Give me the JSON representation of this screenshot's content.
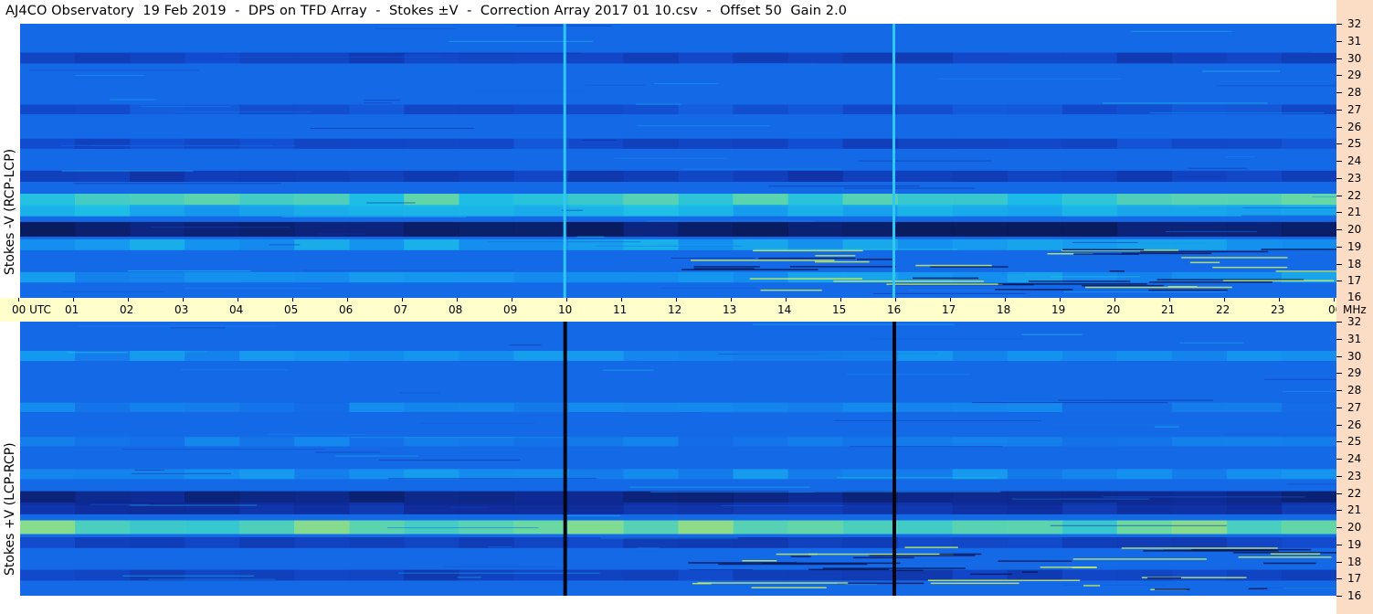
{
  "title": "AJ4CO Observatory  19 Feb 2019  -  DPS on TFD Array  -  Stokes ±V  -  Correction Array 2017 01 10.csv  -  Offset 50  Gain 2.0",
  "panels": [
    {
      "label": "Stokes -V (RCP-LCP)"
    },
    {
      "label": "Stokes +V (LCP-RCP)"
    }
  ],
  "colors": {
    "background": "#ffffff",
    "axis_band": "#ffffcc",
    "freq_band": "#fbdcc4",
    "low": "#0a1a5c",
    "mid": "#1060e0",
    "high": "#f0f060"
  },
  "chart_data": [
    {
      "type": "heatmap",
      "name": "Stokes -V (RCP-LCP)",
      "x": [
        "00 UTC",
        "01",
        "02",
        "03",
        "04",
        "05",
        "06",
        "07",
        "08",
        "09",
        "10",
        "11",
        "12",
        "13",
        "14",
        "15",
        "16",
        "17",
        "18",
        "19",
        "20",
        "21",
        "22",
        "23",
        "00"
      ],
      "y": [
        "16",
        "17",
        "18",
        "19",
        "20",
        "21",
        "22",
        "23",
        "24",
        "25",
        "26",
        "27",
        "28",
        "29",
        "30",
        "31",
        "32"
      ],
      "xlabel": "UTC",
      "ylabel": "MHz",
      "xlim": [
        0,
        24
      ],
      "ylim": [
        16,
        32
      ],
      "bands": [
        {
          "mhz": 30.0,
          "level": -0.35
        },
        {
          "mhz": 27.0,
          "level": -0.2
        },
        {
          "mhz": 25.0,
          "level": -0.25
        },
        {
          "mhz": 23.1,
          "level": -0.4
        },
        {
          "mhz": 21.7,
          "level": 0.65
        },
        {
          "mhz": 21.1,
          "level": 0.45
        },
        {
          "mhz": 20.0,
          "level": -0.9
        },
        {
          "mhz": 19.1,
          "level": 0.35
        },
        {
          "mhz": 17.2,
          "level": 0.3
        }
      ],
      "vertical_lines": [
        {
          "utc": 9.93,
          "kind": "bright"
        },
        {
          "utc": 15.93,
          "kind": "bright"
        }
      ]
    },
    {
      "type": "heatmap",
      "name": "Stokes +V (LCP-RCP)",
      "x": [
        "00 UTC",
        "01",
        "02",
        "03",
        "04",
        "05",
        "06",
        "07",
        "08",
        "09",
        "10",
        "11",
        "12",
        "13",
        "14",
        "15",
        "16",
        "17",
        "18",
        "19",
        "20",
        "21",
        "22",
        "23",
        "00"
      ],
      "y": [
        "16",
        "17",
        "18",
        "19",
        "20",
        "21",
        "22",
        "23",
        "24",
        "25",
        "26",
        "27",
        "28",
        "29",
        "30",
        "31",
        "32"
      ],
      "xlabel": "UTC",
      "ylabel": "MHz",
      "xlim": [
        0,
        24
      ],
      "ylim": [
        16,
        32
      ],
      "bands": [
        {
          "mhz": 30.0,
          "level": 0.25
        },
        {
          "mhz": 27.0,
          "level": 0.15
        },
        {
          "mhz": 25.0,
          "level": 0.15
        },
        {
          "mhz": 23.1,
          "level": 0.25
        },
        {
          "mhz": 21.7,
          "level": -0.75
        },
        {
          "mhz": 21.1,
          "level": -0.5
        },
        {
          "mhz": 20.0,
          "level": 0.75
        },
        {
          "mhz": 19.1,
          "level": -0.35
        },
        {
          "mhz": 17.2,
          "level": -0.35
        }
      ],
      "vertical_lines": [
        {
          "utc": 9.93,
          "kind": "dark"
        },
        {
          "utc": 15.93,
          "kind": "dark"
        }
      ]
    }
  ]
}
